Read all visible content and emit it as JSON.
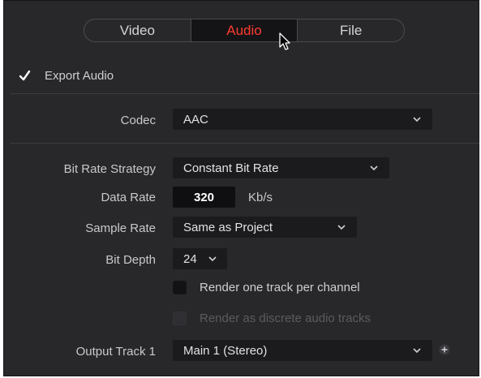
{
  "tabs": [
    {
      "label": "Video",
      "active": false
    },
    {
      "label": "Audio",
      "active": true
    },
    {
      "label": "File",
      "active": false
    }
  ],
  "export_audio": {
    "label": "Export Audio",
    "checked": true
  },
  "codec": {
    "label": "Codec",
    "value": "AAC"
  },
  "bit_rate_strategy": {
    "label": "Bit Rate Strategy",
    "value": "Constant Bit Rate"
  },
  "data_rate": {
    "label": "Data Rate",
    "value": "320",
    "unit": "Kb/s"
  },
  "sample_rate": {
    "label": "Sample Rate",
    "value": "Same as Project"
  },
  "bit_depth": {
    "label": "Bit Depth",
    "value": "24"
  },
  "render_one_track": {
    "label": "Render one track per channel",
    "checked": false
  },
  "render_discrete": {
    "label": "Render as discrete audio tracks",
    "checked": false,
    "disabled": true
  },
  "output_track": {
    "label": "Output Track 1",
    "value": "Main 1 (Stereo)"
  },
  "colors": {
    "panel_bg": "#28282b",
    "active_tab_text": "#ff3b30",
    "field_bg": "#1b1b1e"
  },
  "icons": [
    "checkmark-icon",
    "chevron-down-icon",
    "plus-icon",
    "mouse-cursor-icon"
  ]
}
